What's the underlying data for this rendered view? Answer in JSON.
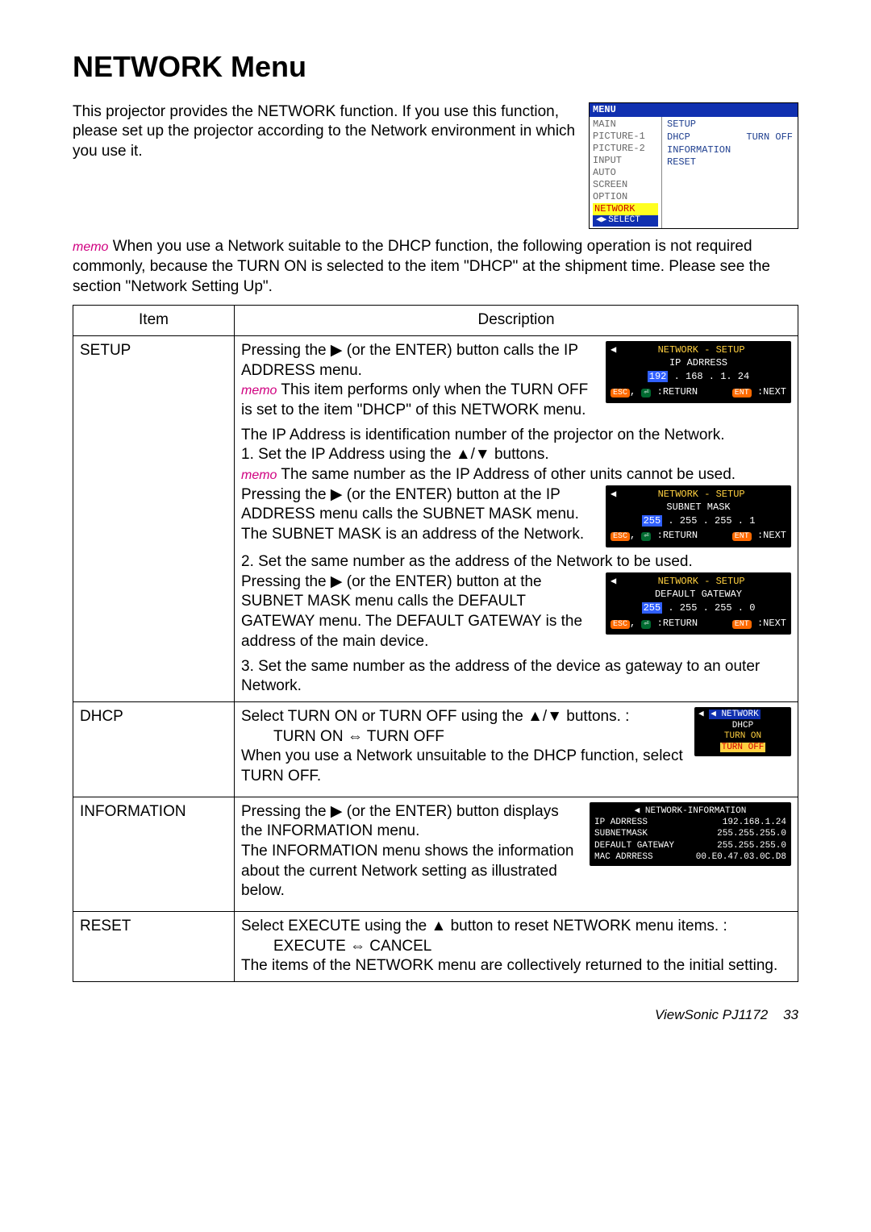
{
  "page": {
    "title": "NETWORK Menu",
    "intro": "This projector provides the NETWORK function. If you use this function, please set up the projector according to the Network environment in which you use it.",
    "memo_label": "memo",
    "memo1": " When you use a Network suitable to the DHCP function, the following operation is not required commonly, because the TURN ON is selected to the item \"DHCP\" at the shipment time. Please see the section \"Network Setting Up\"."
  },
  "thumb": {
    "header": "MENU",
    "left": [
      "MAIN",
      "PICTURE-1",
      "PICTURE-2",
      "INPUT",
      "AUTO",
      "SCREEN",
      "OPTION"
    ],
    "left_highlight": "NETWORK",
    "left_select": "SELECT",
    "right": [
      {
        "l": "SETUP",
        "r": ""
      },
      {
        "l": "DHCP",
        "r": "TURN OFF"
      },
      {
        "l": "INFORMATION",
        "r": ""
      },
      {
        "l": "RESET",
        "r": ""
      }
    ]
  },
  "table": {
    "head_item": "Item",
    "head_desc": "Description",
    "rows": {
      "setup": {
        "item": "SETUP",
        "p1a": "Pressing the ▶ (or the ENTER) button calls the IP ADDRESS menu.",
        "p1_memo": " This item performs only when the TURN OFF is set to the item \"DHCP\" of this NETWORK menu.",
        "p2": "The IP Address is identification number of the projector on the Network.",
        "p3": "1. Set the IP Address using the ▲/▼ buttons.",
        "p3_memo": " The same number as the IP Address of other units cannot be used.",
        "p4": "Pressing the ▶ (or the ENTER) button at the IP ADDRESS menu calls the SUBNET MASK menu. The SUBNET MASK is an address of the Network.",
        "p5": "2. Set the same number as the address of the Network to be used.",
        "p6": "Pressing the ▶ (or the ENTER) button at the SUBNET MASK menu calls the DEFAULT GATEWAY menu. The DEFAULT GATEWAY is the address of the main device.",
        "p7": "3. Set the same number as the address of the device as gateway to an outer Network.",
        "osd1": {
          "title": "NETWORK - SETUP",
          "sub": "IP ADRRESS",
          "ip_pre": "192",
          "ip_rest": " . 168 .   1.   24",
          "ret": ":RETURN",
          "nxt": ":NEXT",
          "esc": "ESC",
          "ent": "ENT"
        },
        "osd2": {
          "title": "NETWORK - SETUP",
          "sub": "SUBNET MASK",
          "ip_pre": "255",
          "ip_rest": " . 255 . 255 .   1",
          "ret": ":RETURN",
          "nxt": ":NEXT",
          "esc": "ESC",
          "ent": "ENT"
        },
        "osd3": {
          "title": "NETWORK - SETUP",
          "sub": "DEFAULT GATEWAY",
          "ip_pre": "255",
          "ip_rest": " . 255 . 255 .   0",
          "ret": ":RETURN",
          "nxt": ":NEXT",
          "esc": "ESC",
          "ent": "ENT"
        }
      },
      "dhcp": {
        "item": "DHCP",
        "p1": "Select TURN ON or TURN OFF using the ▲/▼ buttons. :",
        "p2": "TURN ON ⇔ TURN OFF",
        "p3": "When you use a Network unsuitable to the DHCP function, select TURN OFF.",
        "osd": {
          "hdr": "◀ NETWORK",
          "l1": "DHCP",
          "l2": "TURN ON",
          "l3": "TURN OFF"
        }
      },
      "info": {
        "item": "INFORMATION",
        "p1": "Pressing the ▶ (or the ENTER) button displays the INFORMATION menu.",
        "p2": "The INFORMATION menu shows the information about the current Network setting as illustrated below.",
        "osd": {
          "hdr": "◀   NETWORK-INFORMATION",
          "r1l": "IP ADRRESS",
          "r1r": "192.168.1.24",
          "r2l": "SUBNETMASK",
          "r2r": "255.255.255.0",
          "r3l": "DEFAULT GATEWAY",
          "r3r": "255.255.255.0",
          "r4l": "MAC ADRRESS",
          "r4r": "00.E0.47.03.0C.D8"
        }
      },
      "reset": {
        "item": "RESET",
        "p1": "Select EXECUTE using the ▲ button to reset NETWORK menu items. :",
        "p2": "EXECUTE ⇔ CANCEL",
        "p3": "The items of the NETWORK menu are collectively returned to the initial setting."
      }
    }
  },
  "footer": {
    "brand": "ViewSonic  PJ1172",
    "page": "33"
  }
}
